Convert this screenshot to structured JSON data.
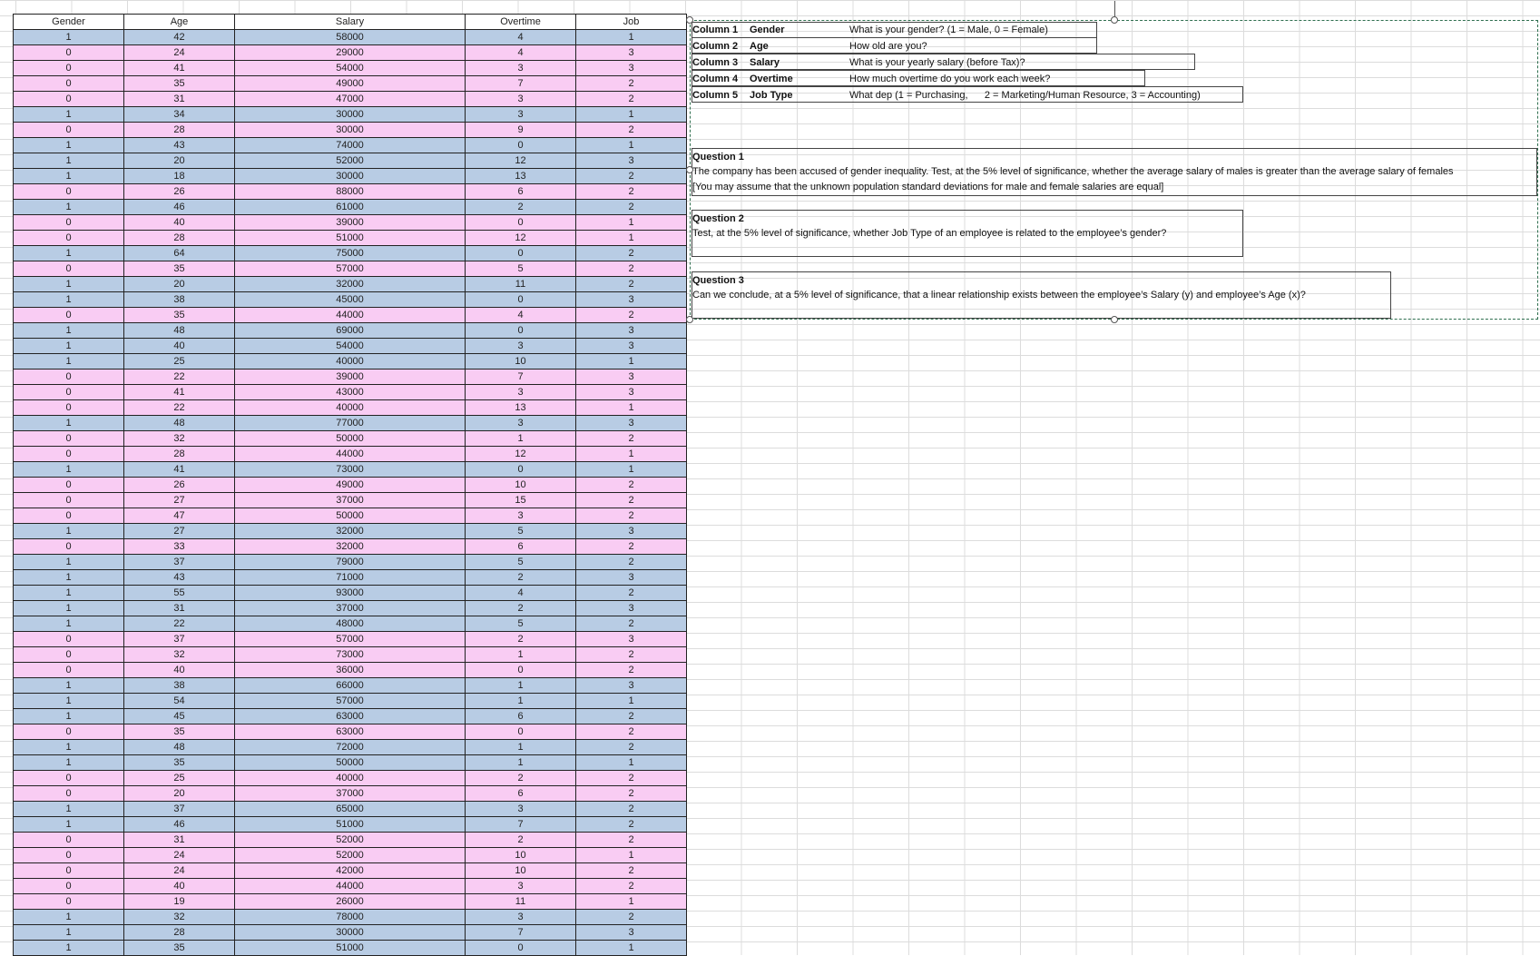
{
  "table": {
    "headers": [
      "Gender",
      "Age",
      "Salary",
      "Overtime",
      "Job"
    ],
    "rows": [
      [
        1,
        42,
        58000,
        4,
        1
      ],
      [
        0,
        24,
        29000,
        4,
        3
      ],
      [
        0,
        41,
        54000,
        3,
        3
      ],
      [
        0,
        35,
        49000,
        7,
        2
      ],
      [
        0,
        31,
        47000,
        3,
        2
      ],
      [
        1,
        34,
        30000,
        3,
        1
      ],
      [
        0,
        28,
        30000,
        9,
        2
      ],
      [
        1,
        43,
        74000,
        0,
        1
      ],
      [
        1,
        20,
        52000,
        12,
        3
      ],
      [
        1,
        18,
        30000,
        13,
        2
      ],
      [
        0,
        26,
        88000,
        6,
        2
      ],
      [
        1,
        46,
        61000,
        2,
        2
      ],
      [
        0,
        40,
        39000,
        0,
        1
      ],
      [
        0,
        28,
        51000,
        12,
        1
      ],
      [
        1,
        64,
        75000,
        0,
        2
      ],
      [
        0,
        35,
        57000,
        5,
        2
      ],
      [
        1,
        20,
        32000,
        11,
        2
      ],
      [
        1,
        38,
        45000,
        0,
        3
      ],
      [
        0,
        35,
        44000,
        4,
        2
      ],
      [
        1,
        48,
        69000,
        0,
        3
      ],
      [
        1,
        40,
        54000,
        3,
        3
      ],
      [
        1,
        25,
        40000,
        10,
        1
      ],
      [
        0,
        22,
        39000,
        7,
        3
      ],
      [
        0,
        41,
        43000,
        3,
        3
      ],
      [
        0,
        22,
        40000,
        13,
        1
      ],
      [
        1,
        48,
        77000,
        3,
        3
      ],
      [
        0,
        32,
        50000,
        1,
        2
      ],
      [
        0,
        28,
        44000,
        12,
        1
      ],
      [
        1,
        41,
        73000,
        0,
        1
      ],
      [
        0,
        26,
        49000,
        10,
        2
      ],
      [
        0,
        27,
        37000,
        15,
        2
      ],
      [
        0,
        47,
        50000,
        3,
        2
      ],
      [
        1,
        27,
        32000,
        5,
        3
      ],
      [
        0,
        33,
        32000,
        6,
        2
      ],
      [
        1,
        37,
        79000,
        5,
        2
      ],
      [
        1,
        43,
        71000,
        2,
        3
      ],
      [
        1,
        55,
        93000,
        4,
        2
      ],
      [
        1,
        31,
        37000,
        2,
        3
      ],
      [
        1,
        22,
        48000,
        5,
        2
      ],
      [
        0,
        37,
        57000,
        2,
        3
      ],
      [
        0,
        32,
        73000,
        1,
        2
      ],
      [
        0,
        40,
        36000,
        0,
        2
      ],
      [
        1,
        38,
        66000,
        1,
        3
      ],
      [
        1,
        54,
        57000,
        1,
        1
      ],
      [
        1,
        45,
        63000,
        6,
        2
      ],
      [
        0,
        35,
        63000,
        0,
        2
      ],
      [
        1,
        48,
        72000,
        1,
        2
      ],
      [
        1,
        35,
        50000,
        1,
        1
      ],
      [
        0,
        25,
        40000,
        2,
        2
      ],
      [
        0,
        20,
        37000,
        6,
        2
      ],
      [
        1,
        37,
        65000,
        3,
        2
      ],
      [
        1,
        46,
        51000,
        7,
        2
      ],
      [
        0,
        31,
        52000,
        2,
        2
      ],
      [
        0,
        24,
        52000,
        10,
        1
      ],
      [
        0,
        24,
        42000,
        10,
        2
      ],
      [
        0,
        40,
        44000,
        3,
        2
      ],
      [
        0,
        19,
        26000,
        11,
        1
      ],
      [
        1,
        32,
        78000,
        3,
        2
      ],
      [
        1,
        28,
        30000,
        7,
        3
      ],
      [
        1,
        35,
        51000,
        0,
        1
      ]
    ]
  },
  "legend": {
    "col1_id": "Column 1",
    "col1_name": "Gender",
    "col1_q": "What is your gender? (1 = Male, 0 = Female)",
    "col2_id": "Column 2",
    "col2_name": "Age",
    "col2_q": "How old are you?",
    "col3_id": "Column 3",
    "col3_name": "Salary",
    "col3_q": "What is your yearly salary (before Tax)?",
    "col4_id": "Column 4",
    "col4_name": "Overtime",
    "col4_q": "How much overtime do you work each week?",
    "col5_id": "Column 5",
    "col5_name": "Job Type",
    "col5_q": "What dep (1 = Purchasing,      2 = Marketing/Human Resource, 3 = Accounting)"
  },
  "questions": {
    "q1_title": "Question 1",
    "q1_line1": "The company has been accused of gender inequality. Test, at the 5% level of significance, whether the average salary of males is greater than the average salary of females",
    "q1_line2": "[You may assume that the unknown population standard deviations for male and female salaries are equal]",
    "q2_title": "Question 2",
    "q2_line1": "Test, at the 5% level of significance, whether Job Type of an employee is related to the employee’s gender?",
    "q3_title": "Question 3",
    "q3_line1": "Can we conclude, at a 5% level of significance, that a linear relationship exists between the employee’s Salary (y) and employee’s Age (x)?"
  },
  "colors": {
    "male_row": "#b8cce4",
    "female_row": "#f9ccf3"
  }
}
